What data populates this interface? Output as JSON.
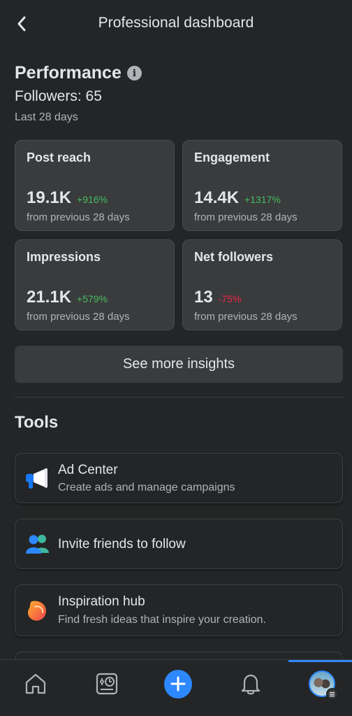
{
  "header": {
    "title": "Professional dashboard"
  },
  "performance": {
    "title": "Performance",
    "followers": "Followers: 65",
    "period": "Last 28 days",
    "cards": [
      {
        "label": "Post reach",
        "value": "19.1K",
        "change": "+916%",
        "trend": "up",
        "sub": "from previous 28 days"
      },
      {
        "label": "Engagement",
        "value": "14.4K",
        "change": "+1317%",
        "trend": "up",
        "sub": "from previous 28 days"
      },
      {
        "label": "Impressions",
        "value": "21.1K",
        "change": "+579%",
        "trend": "up",
        "sub": "from previous 28 days"
      },
      {
        "label": "Net followers",
        "value": "13",
        "change": "-75%",
        "trend": "down",
        "sub": "from previous 28 days"
      }
    ],
    "see_more": "See more insights"
  },
  "tools": {
    "title": "Tools",
    "items": [
      {
        "title": "Ad Center",
        "desc": "Create ads and manage campaigns",
        "icon": "megaphone-icon"
      },
      {
        "title": "Invite friends to follow",
        "desc": "",
        "icon": "friends-icon"
      },
      {
        "title": "Inspiration hub",
        "desc": "Find fresh ideas that inspire your creation.",
        "icon": "inspiration-icon"
      }
    ]
  },
  "nav": {
    "items": [
      "home-icon",
      "dashboard-icon",
      "create-icon",
      "bell-icon",
      "profile-avatar"
    ],
    "active": "profile-avatar"
  },
  "colors": {
    "accent": "#2d88ff",
    "positive": "#45bd62",
    "negative": "#f02849"
  }
}
